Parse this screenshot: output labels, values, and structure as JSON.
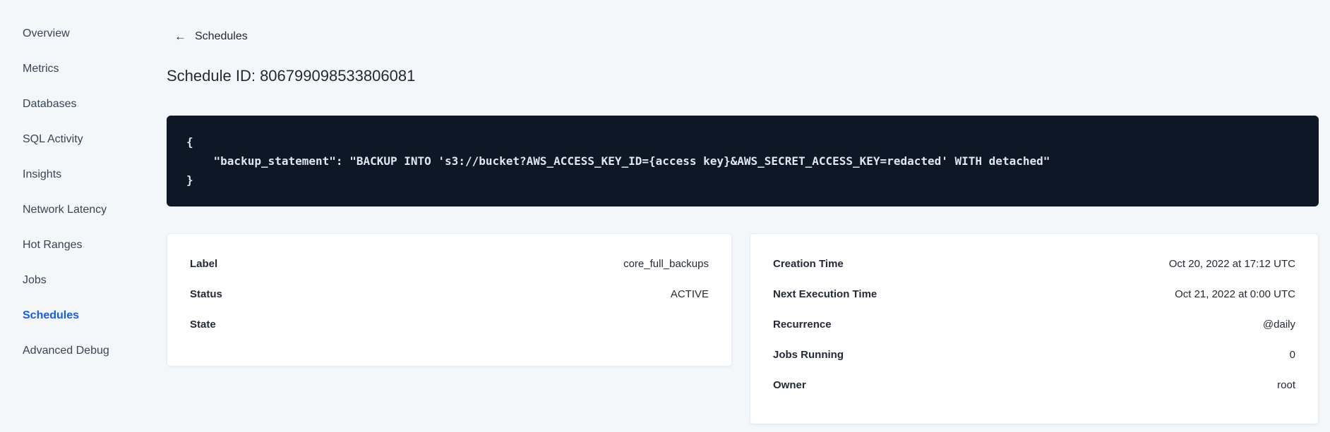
{
  "colors": {
    "accent_blue": "#165cf0",
    "code_block_bg": "#0e1726",
    "code_text": "#dfe6ee",
    "page_bg": "#f4f7fa",
    "text_dark": "#242a35",
    "sidebar_text": "#394455"
  },
  "sidebar": {
    "items": [
      {
        "label": "Overview",
        "active": false
      },
      {
        "label": "Metrics",
        "active": false
      },
      {
        "label": "Databases",
        "active": false
      },
      {
        "label": "SQL Activity",
        "active": false
      },
      {
        "label": "Insights",
        "active": false
      },
      {
        "label": "Network Latency",
        "active": false
      },
      {
        "label": "Hot Ranges",
        "active": false
      },
      {
        "label": "Jobs",
        "active": false
      },
      {
        "label": "Schedules",
        "active": true
      },
      {
        "label": "Advanced Debug",
        "active": false
      }
    ]
  },
  "main": {
    "back_link": {
      "arrow_icon": "←",
      "label": "Schedules"
    },
    "page_title": "Schedule ID: 806799098533806081",
    "code_block": {
      "lines": [
        "{",
        "    \"backup_statement\": \"BACKUP INTO 's3://bucket?AWS_ACCESS_KEY_ID={access key}&AWS_SECRET_ACCESS_KEY=redacted' WITH detached\"",
        "}"
      ]
    },
    "cards": {
      "left": {
        "rows": [
          {
            "label": "Label",
            "value": "core_full_backups"
          },
          {
            "label": "Status",
            "value": "ACTIVE"
          },
          {
            "label": "State",
            "value": ""
          }
        ]
      },
      "right": {
        "rows": [
          {
            "label": "Creation Time",
            "value": "Oct 20, 2022 at 17:12 UTC"
          },
          {
            "label": "Next Execution Time",
            "value": "Oct 21, 2022 at 0:00 UTC"
          },
          {
            "label": "Recurrence",
            "value": "@daily"
          },
          {
            "label": "Jobs Running",
            "value": "0"
          },
          {
            "label": "Owner",
            "value": "root"
          }
        ]
      }
    }
  }
}
